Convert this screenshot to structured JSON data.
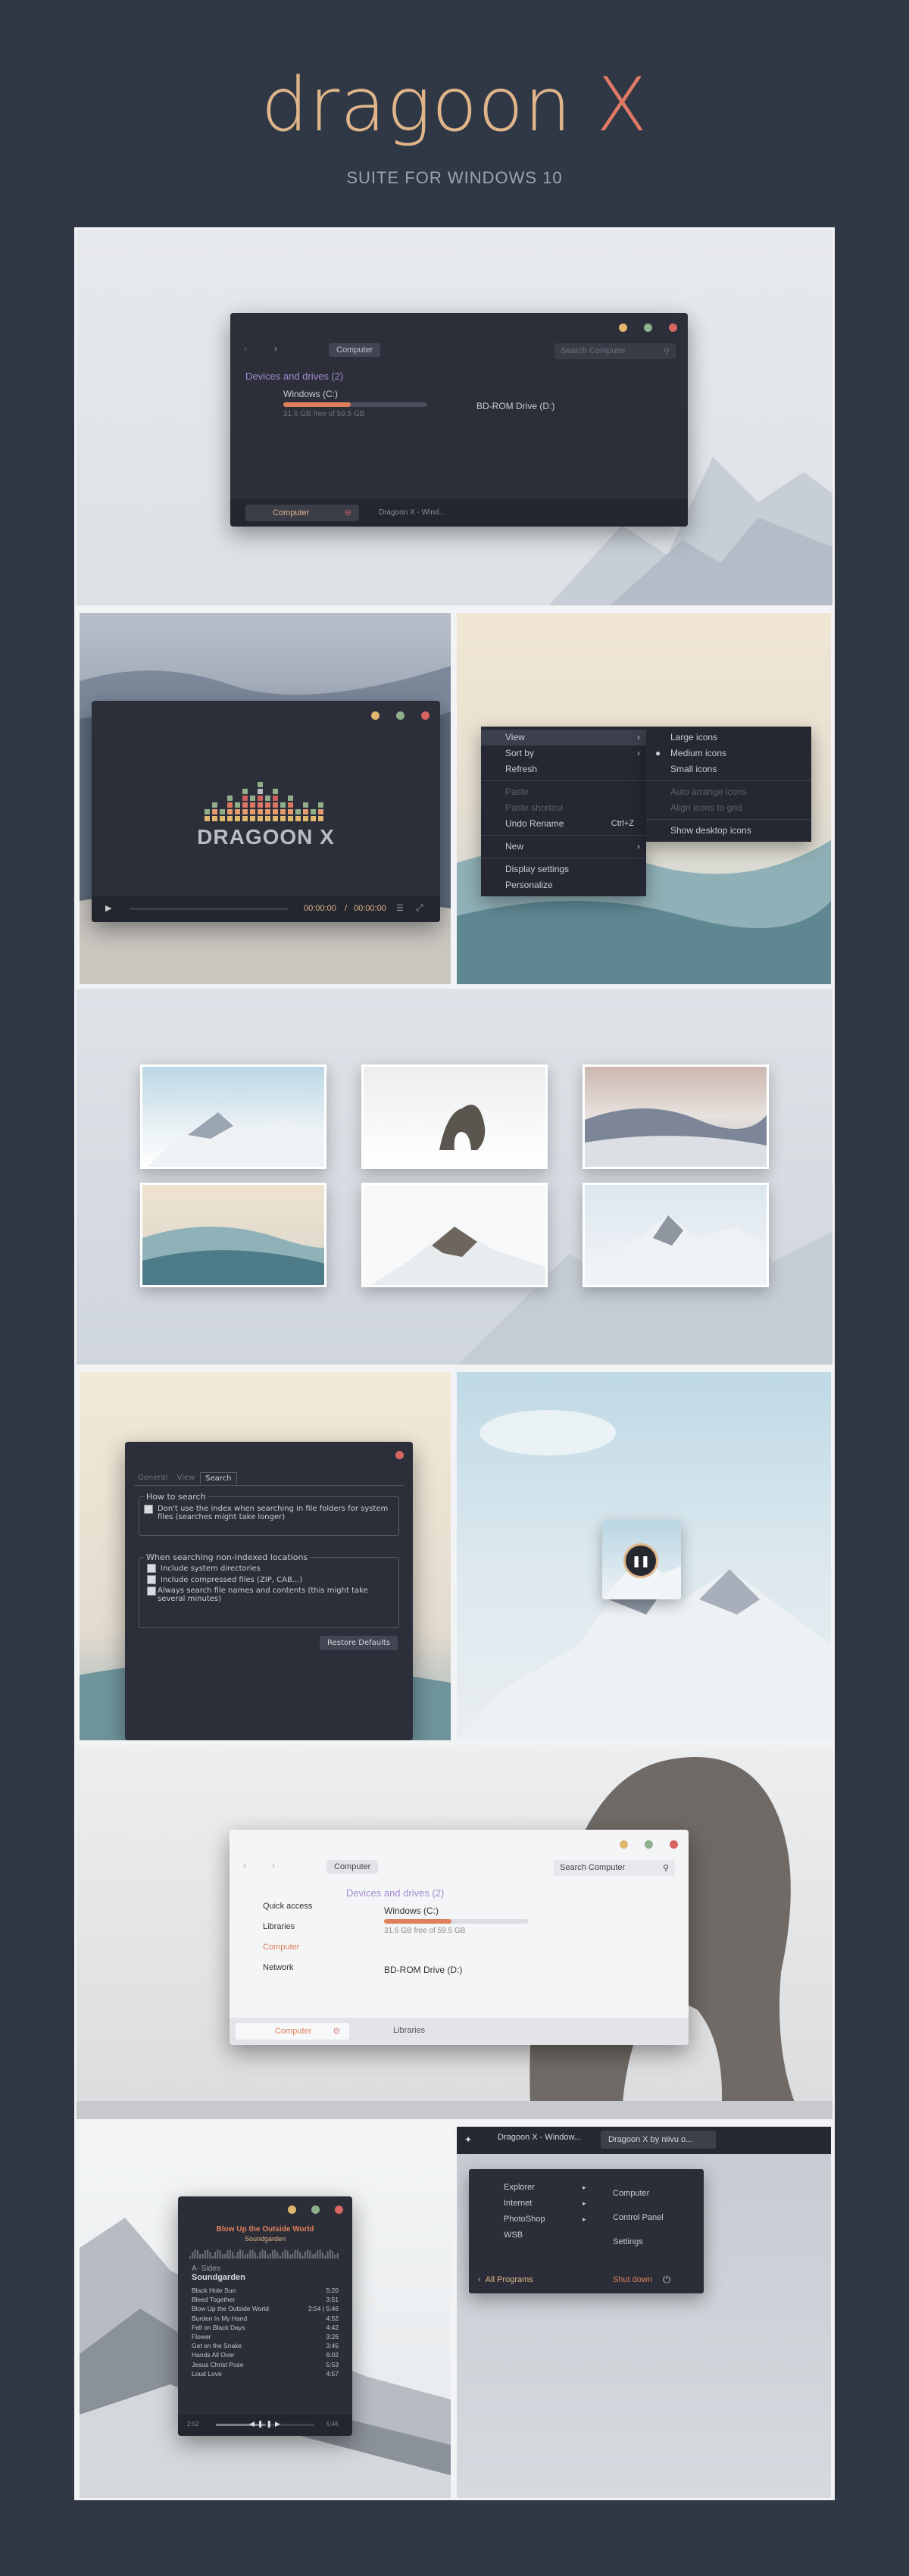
{
  "hero": {
    "title_main": "dragoon ",
    "title_x": "X",
    "subtitle": "SUITE FOR WINDOWS 10"
  },
  "explorer_dark": {
    "breadcrumb": "Computer",
    "search_placeholder": "Search Computer",
    "section": "Devices and drives (2)",
    "drive1_name": "Windows (C:)",
    "drive1_free": "31.6 GB free of 59.5 GB",
    "drive1_usage": 0.47,
    "drive2_name": "BD-ROM Drive (D:)",
    "tab_active": "Computer",
    "tab_inactive": "Dragoon X - Wind..."
  },
  "player": {
    "logo_text": "DRAGOON X",
    "time_current": "00:00:00",
    "time_sep": "/",
    "time_total": "00:00:00"
  },
  "context_menu": {
    "items": [
      "View",
      "Sort by",
      "Refresh",
      "Paste",
      "Paste shortcut",
      "Undo Rename",
      "Ctrl+Z",
      "New",
      "Display settings",
      "Personalize"
    ],
    "sub_items": [
      "Large icons",
      "Medium icons",
      "Small icons",
      "Auto arrange icons",
      "Align icons to grid",
      "Show desktop icons"
    ]
  },
  "search_dialog": {
    "tabs": [
      "General",
      "View",
      "Search"
    ],
    "group1": "How to search",
    "opt1": "Don't use the index when searching in file folders for system files (searches might take longer)",
    "group2": "When searching non-indexed locations",
    "opt2": "Include system directories",
    "opt3": "Include compressed files (ZIP, CAB...)",
    "opt4": "Always search file names and contents (this might take several minutes)",
    "restore_button": "Restore Defaults"
  },
  "explorer_light": {
    "breadcrumb": "Computer",
    "search_placeholder": "Search Computer",
    "nav": [
      "Quick access",
      "Libraries",
      "Computer",
      "Network"
    ],
    "section": "Devices and drives (2)",
    "drive1_name": "Windows (C:)",
    "drive1_free": "31.6 GB free of 59.5 GB",
    "drive1_usage": 0.47,
    "drive2_name": "BD-ROM Drive (D:)",
    "tab_active": "Computer",
    "tab_inactive": "Libraries"
  },
  "music": {
    "song": "Blow Up the Outside World",
    "artist": "Soundgarden",
    "album": "A- Sides",
    "album_artist": "Soundgarden",
    "tracks": [
      {
        "title": "Black Hole Sun",
        "len": "5:20"
      },
      {
        "title": "Bleed Together",
        "len": "3:51"
      },
      {
        "title": "Blow Up the Outside World",
        "len": "2:54 | 5:46"
      },
      {
        "title": "Burden In My Hand",
        "len": "4:52"
      },
      {
        "title": "Fell on Black Days",
        "len": "4:42"
      },
      {
        "title": "Flower",
        "len": "3:26"
      },
      {
        "title": "Get on the Snake",
        "len": "3:45"
      },
      {
        "title": "Hands All Over",
        "len": "6:02"
      },
      {
        "title": "Jesus Christ Pose",
        "len": "5:53"
      },
      {
        "title": "Loud Love",
        "len": "4:57"
      }
    ],
    "time_left": "2:52",
    "time_right": "5:46"
  },
  "taskbar": {
    "item1": "Dragoon X - Window...",
    "item2": "Dragoon X by niivu o..."
  },
  "start_menu": {
    "left": [
      "Explorer",
      "Internet",
      "PhotoShop",
      "WSB"
    ],
    "right": [
      "Computer",
      "Control Panel",
      "Settings"
    ],
    "all_programs": "All Programs",
    "shutdown": "Shut down"
  },
  "colors": {
    "bg": "#303845",
    "accent_orange": "#e0805a",
    "title_gold": "#e0b58a",
    "purple": "#a28ad0"
  }
}
